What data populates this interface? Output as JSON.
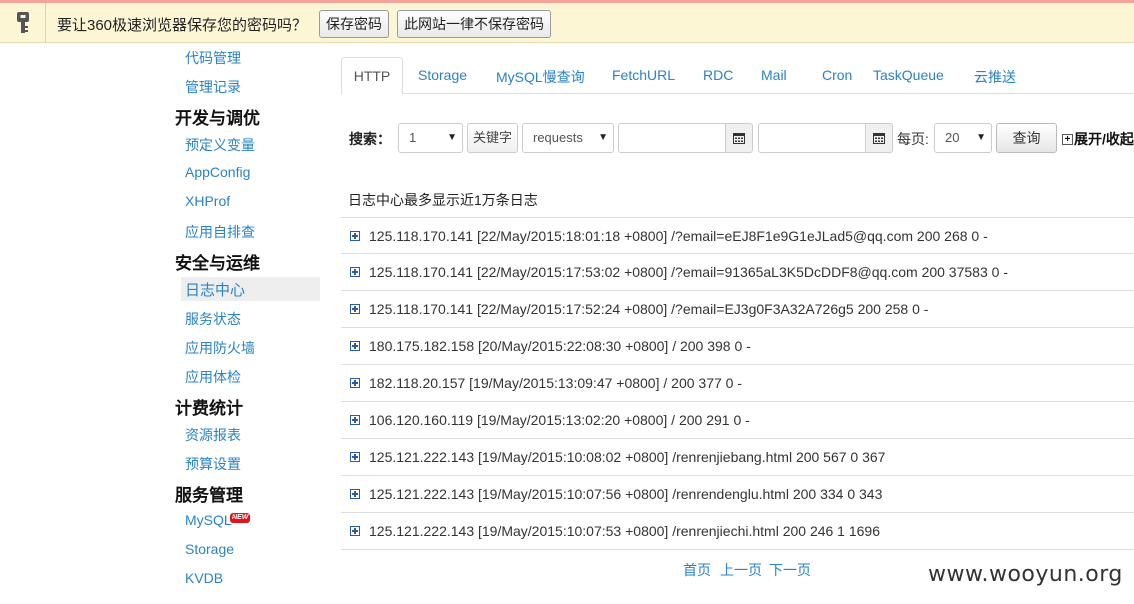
{
  "password_bar": {
    "message": "要让360极速浏览器保存您的密码吗？",
    "save_button": "保存密码",
    "never_button": "此网站一律不保存密码",
    "icon": "key-icon"
  },
  "sidebar": {
    "items": [
      {
        "label": "代码管理",
        "type": "link"
      },
      {
        "label": "管理记录",
        "type": "link"
      },
      {
        "label": "开发与调优",
        "type": "heading"
      },
      {
        "label": "预定义变量",
        "type": "link"
      },
      {
        "label": "AppConfig",
        "type": "link"
      },
      {
        "label": "XHProf",
        "type": "link"
      },
      {
        "label": "应用自排查",
        "type": "link"
      },
      {
        "label": "安全与运维",
        "type": "heading"
      },
      {
        "label": "日志中心",
        "type": "active"
      },
      {
        "label": "服务状态",
        "type": "link"
      },
      {
        "label": "应用防火墙",
        "type": "link"
      },
      {
        "label": "应用体检",
        "type": "link"
      },
      {
        "label": "计费统计",
        "type": "heading"
      },
      {
        "label": "资源报表",
        "type": "link"
      },
      {
        "label": "预算设置",
        "type": "link"
      },
      {
        "label": "服务管理",
        "type": "heading"
      },
      {
        "label": "MySQL",
        "type": "link"
      },
      {
        "label": "Storage",
        "type": "link"
      },
      {
        "label": "KVDB",
        "type": "link"
      }
    ],
    "new_badge": "NEW"
  },
  "tabs": [
    "HTTP",
    "Storage",
    "MySQL慢查询",
    "FetchURL",
    "RDC",
    "Mail",
    "Cron",
    "TaskQueue",
    "云推送"
  ],
  "search": {
    "label": "搜索：",
    "select1": "1",
    "keyword_button": "关键字",
    "type_select": "requests",
    "date_from": "",
    "date_to": "",
    "per_page_label": "每页:",
    "per_page_value": "20",
    "query_button": "查询",
    "expand_label": "展开/收起"
  },
  "notice": "日志中心最多显示近1万条日志",
  "logs": [
    "125.118.170.141 [22/May/2015:18:01:18 +0800] /?email=eEJ8F1e9G1eJLad5@qq.com 200 268 0 -",
    "125.118.170.141 [22/May/2015:17:53:02 +0800] /?email=91365aL3K5DcDDF8@qq.com 200 37583 0 -",
    "125.118.170.141 [22/May/2015:17:52:24 +0800] /?email=EJ3g0F3A32A726g5 200 258 0 -",
    "180.175.182.158 [20/May/2015:22:08:30 +0800] / 200 398 0 -",
    "182.118.20.157 [19/May/2015:13:09:47 +0800] / 200 377 0 -",
    "106.120.160.119 [19/May/2015:13:02:20 +0800] / 200 291 0 -",
    "125.121.222.143 [19/May/2015:10:08:02 +0800] /renrenjiebang.html 200 567 0 367",
    "125.121.222.143 [19/May/2015:10:07:56 +0800] /renrendenglu.html 200 334 0 343",
    "125.121.222.143 [19/May/2015:10:07:53 +0800] /renrenjiechi.html 200 246 1 1696"
  ],
  "pager": {
    "first": "首页",
    "prev": "上一页",
    "next": "下一页"
  },
  "watermark": "www.wooyun.org"
}
